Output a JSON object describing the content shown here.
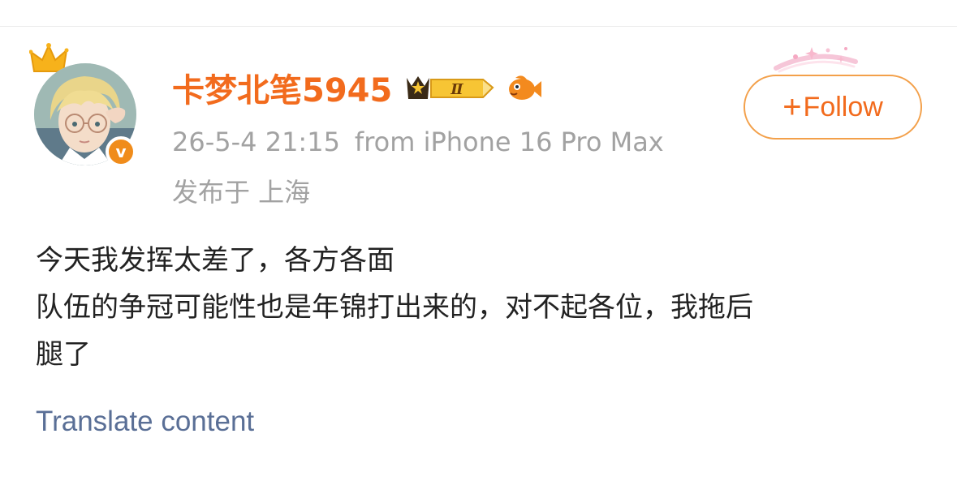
{
  "user": {
    "name": "卡梦北笔5945",
    "vip_level": "Ⅱ",
    "verified_mark": "v"
  },
  "post": {
    "timestamp": "26-5-4 21:15",
    "source": "from iPhone 16 Pro Max",
    "location": "发布于 上海",
    "lines": [
      "今天我发挥太差了，各方各面",
      "队伍的争冠可能性也是年锦打出来的，对不起各位，我拖后",
      "腿了"
    ]
  },
  "actions": {
    "follow_label": "Follow",
    "follow_plus": "+",
    "translate_label": "Translate content"
  },
  "icons": {
    "crown": "crown-icon",
    "vip": "vip-crown-badge-icon",
    "fish": "fish-icon",
    "sparkle": "sparkle-decoration-icon",
    "plus": "plus-icon"
  },
  "colors": {
    "accent": "#f26b1d",
    "follow_border": "#f3a04a",
    "meta_text": "#a2a2a2",
    "body_text": "#222222",
    "link": "#5a6f96",
    "verified": "#f08c1b"
  }
}
